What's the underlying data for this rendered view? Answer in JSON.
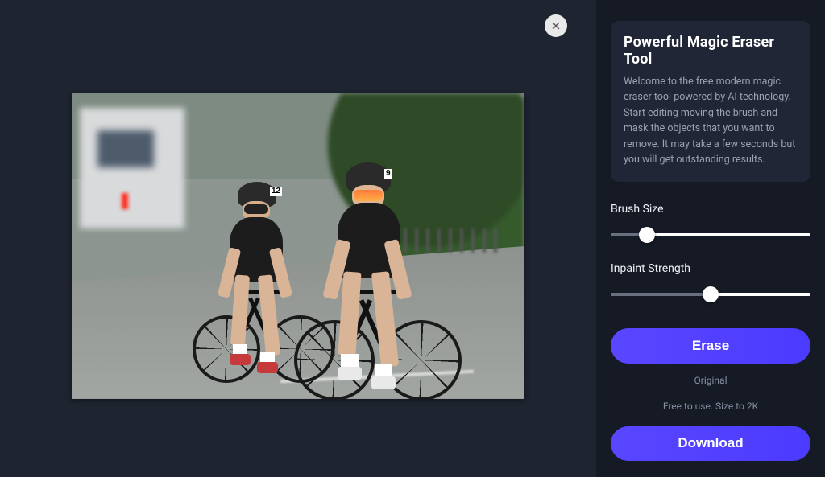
{
  "canvas": {
    "close_label": "Close"
  },
  "image": {
    "bib_front": "9",
    "bib_back": "12"
  },
  "sidebar": {
    "title": "Powerful Magic Eraser Tool",
    "description": "Welcome to the free modern magic eraser tool powered by AI technology. Start editing moving the brush and mask the objects that you want to remove. It may take a few seconds but you will get outstanding results.",
    "brush_label": "Brush Size",
    "brush_value_pct": 18,
    "inpaint_label": "Inpaint Strength",
    "inpaint_value_pct": 50,
    "erase_label": "Erase",
    "original_label": "Original",
    "free_line": "Free to use. Size to 2K",
    "download_label": "Download"
  },
  "colors": {
    "accent": "#4b3bff",
    "bg_dark": "#1e2430",
    "panel": "#151a25"
  }
}
